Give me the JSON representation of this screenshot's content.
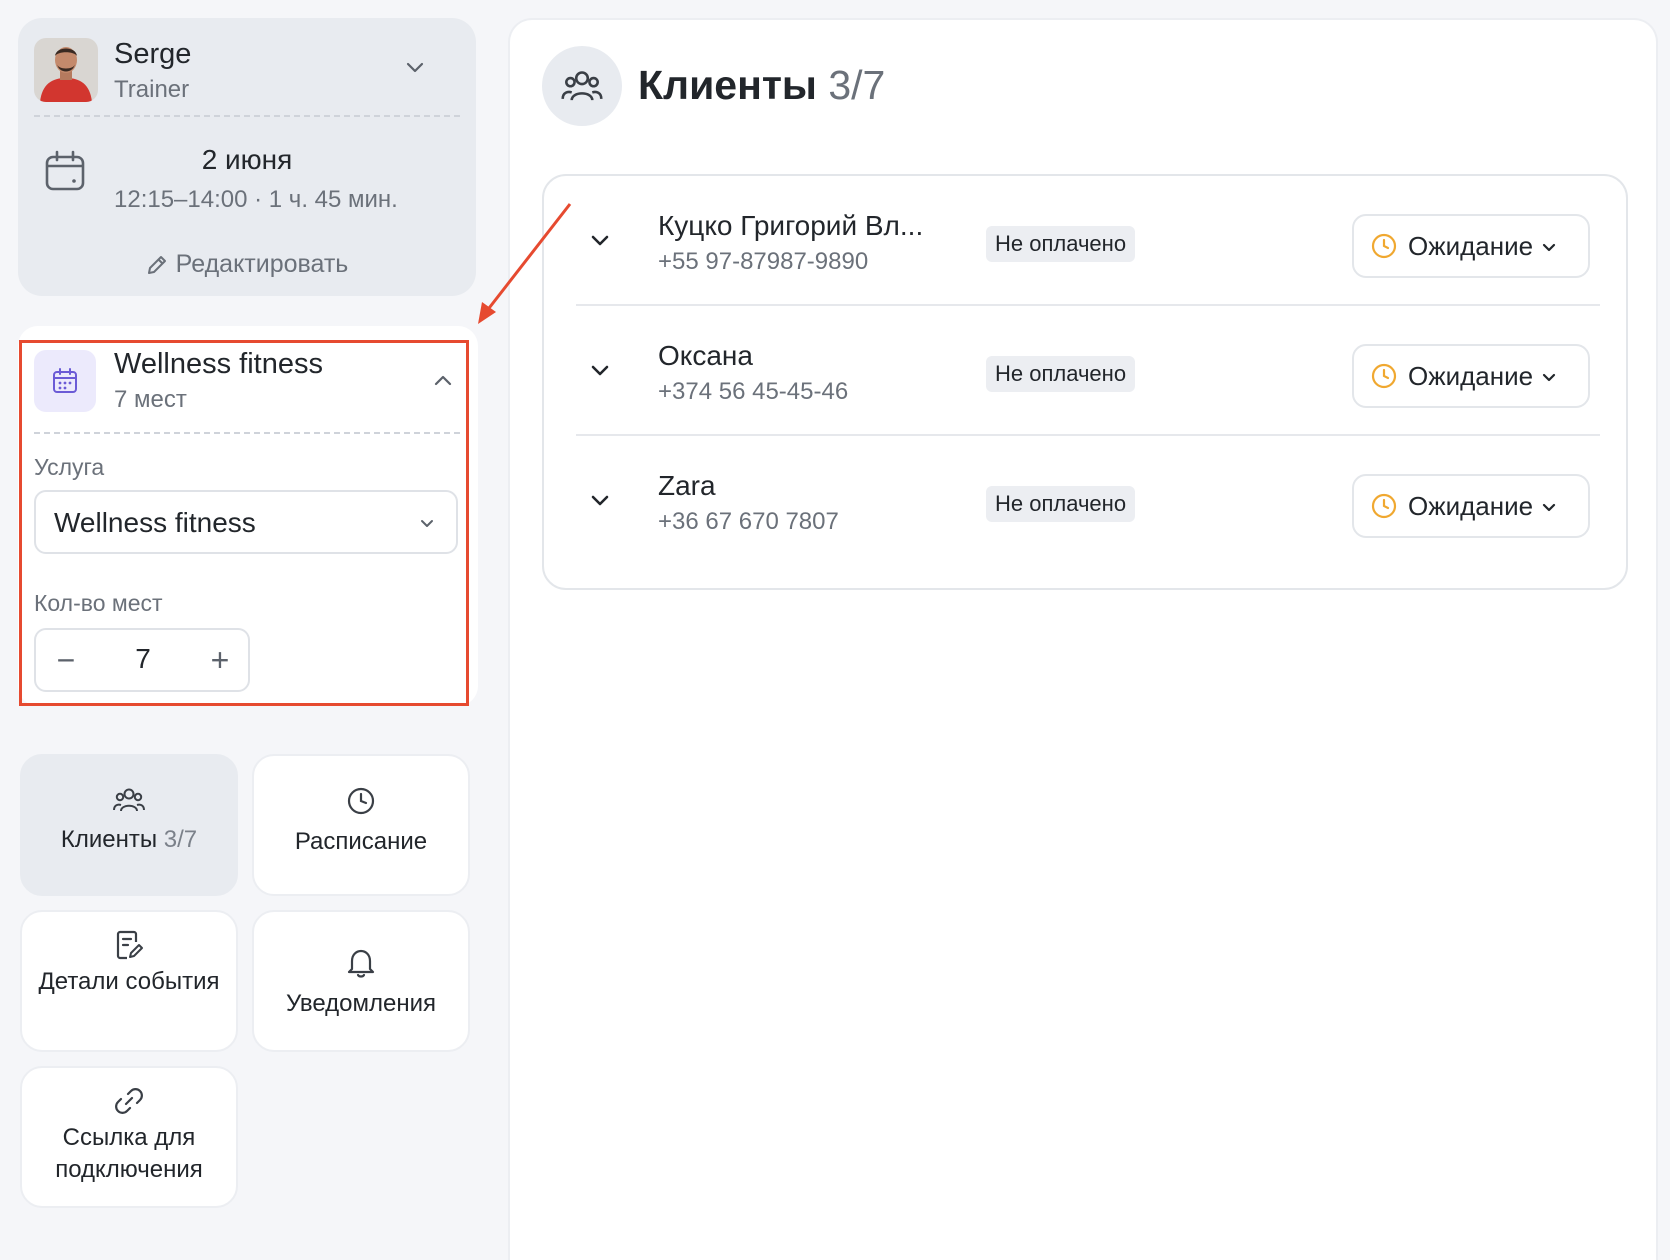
{
  "trainer": {
    "name": "Serge",
    "role": "Trainer",
    "date": "2 июня",
    "time": "12:15–14:00 · 1 ч. 45 мин.",
    "edit_label": "Редактировать"
  },
  "service_card": {
    "title": "Wellness fitness",
    "subtitle": "7 мест",
    "service_label": "Услуга",
    "service_value": "Wellness fitness",
    "seats_label": "Кол-во мест",
    "seats_value": "7",
    "decrement": "−",
    "increment": "+"
  },
  "nav": [
    {
      "label": "Клиенты",
      "count": "3/7",
      "icon": "users-icon",
      "active": true
    },
    {
      "label": "Расписание",
      "icon": "clock-icon",
      "active": false
    },
    {
      "label": "Детали события",
      "icon": "note-edit-icon",
      "active": false
    },
    {
      "label": "Уведомления",
      "icon": "bell-icon",
      "active": false
    },
    {
      "label": "Ссылка для подключения",
      "icon": "link-icon",
      "active": false
    }
  ],
  "header": {
    "title": "Клиенты",
    "count": "3/7"
  },
  "clients": [
    {
      "name": "Куцко Григорий Вл...",
      "phone": "+55 97-87987-9890",
      "payment": "Не оплачено",
      "status": "Ожидание"
    },
    {
      "name": "Оксана",
      "phone": "+374 56 45-45-46",
      "payment": "Не оплачено",
      "status": "Ожидание"
    },
    {
      "name": "Zara",
      "phone": "+36 67 670 7807",
      "payment": "Не оплачено",
      "status": "Ожидание"
    }
  ],
  "colors": {
    "highlight": "#e64a30",
    "status_clock": "#f0a830",
    "service_icon": "#6b5bd6"
  }
}
